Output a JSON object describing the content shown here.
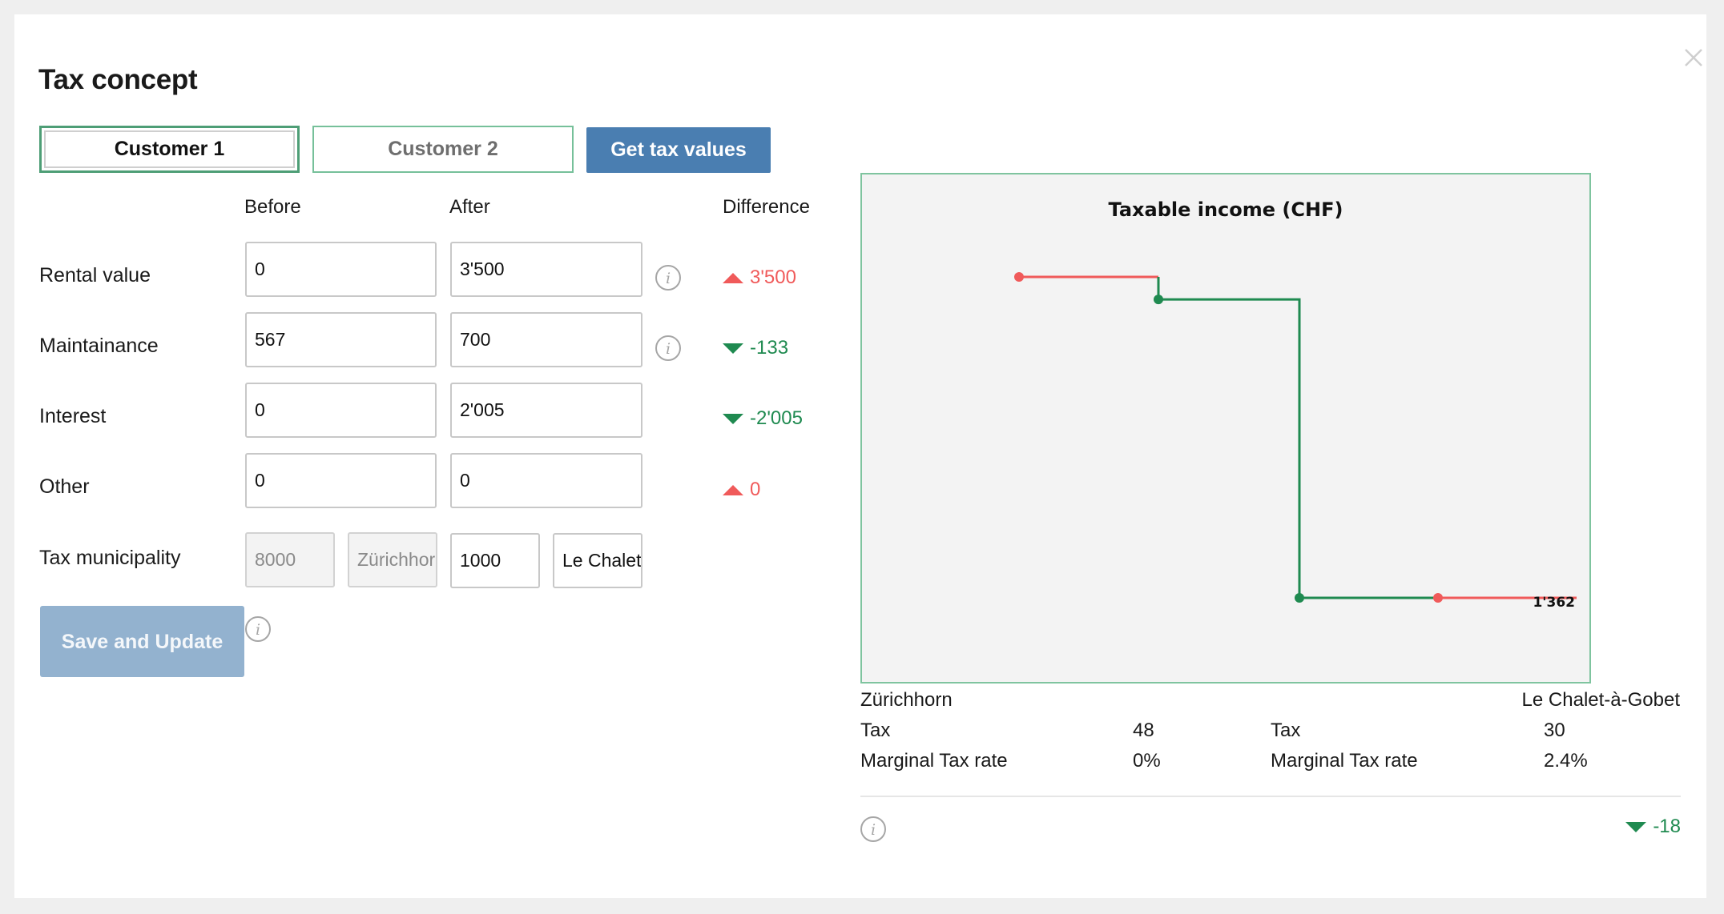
{
  "dialog": {
    "title": "Tax concept"
  },
  "tabs": [
    {
      "label": "Customer 1",
      "active": true
    },
    {
      "label": "Customer 2",
      "active": false
    }
  ],
  "get_tax_button": "Get tax values",
  "columns": {
    "before": "Before",
    "after": "After",
    "difference": "Difference"
  },
  "rows": [
    {
      "label": "Rental value",
      "before": "0",
      "after": "3'500",
      "diff": "3'500",
      "direction": "up",
      "has_info": true
    },
    {
      "label": "Maintainance",
      "before": "567",
      "after": "700",
      "diff": "-133",
      "direction": "down",
      "has_info": true
    },
    {
      "label": "Interest",
      "before": "0",
      "after": "2'005",
      "diff": "-2'005",
      "direction": "down",
      "has_info": false
    },
    {
      "label": "Other",
      "before": "0",
      "after": "0",
      "diff": "0",
      "direction": "up",
      "has_info": false
    }
  ],
  "municipality": {
    "label": "Tax municipality",
    "before_zip": "8000",
    "before_name": "Zürichhorn",
    "after_zip": "1000",
    "after_name": "Le Chalet-à-Gobet"
  },
  "save_button": "Save and Update",
  "chart_data": {
    "type": "line",
    "title": "Taxable income (CHF)",
    "series": [
      {
        "color": "#f05a5a",
        "y": [
          1,
          1
        ]
      },
      {
        "color": "#1f8a50",
        "y": [
          0.93,
          0.93,
          0,
          0
        ]
      },
      {
        "color": "#f05a5a",
        "y": [
          0,
          0
        ]
      }
    ],
    "end_label": "1'362",
    "grid": false
  },
  "summary": {
    "left_place": "Zürichhorn",
    "right_place": "Le Chalet-à-Gobet",
    "tax_label": "Tax",
    "rate_label": "Marginal Tax rate",
    "left_tax": "48",
    "left_rate": "0%",
    "right_tax": "30",
    "right_rate": "2.4%",
    "total_diff": "-18"
  },
  "colors": {
    "accent": "#4a7eb1",
    "positive": "#1f8a50",
    "negative": "#f05a5a",
    "tab_border": "#76c09a"
  },
  "icons": {
    "close": "close-icon",
    "info": "info-icon"
  }
}
